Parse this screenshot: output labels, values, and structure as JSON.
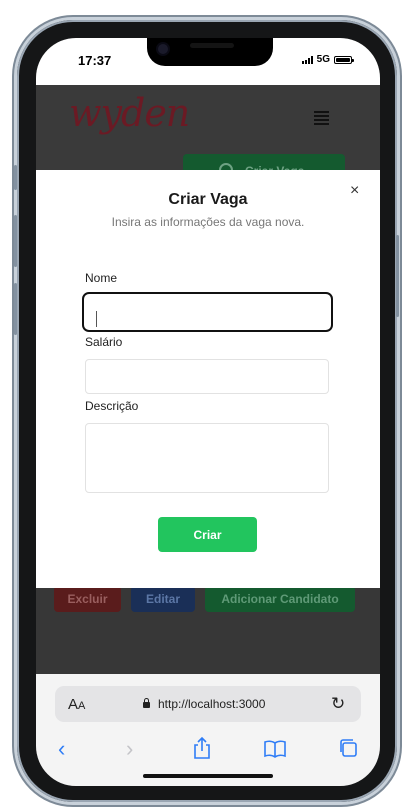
{
  "status": {
    "time": "17:37",
    "network": "5G"
  },
  "app": {
    "logo": "wyden",
    "create_button": "Criar Vaga",
    "row_buttons": {
      "delete": "Excluir",
      "edit": "Editar",
      "add": "Adicionar Candidato"
    }
  },
  "modal": {
    "title": "Criar Vaga",
    "subtitle": "Insira as informações da vaga nova.",
    "close": "×",
    "fields": {
      "name_label": "Nome",
      "name_value": "",
      "salary_label": "Salário",
      "salary_value": "",
      "description_label": "Descrição",
      "description_value": ""
    },
    "submit": "Criar"
  },
  "safari": {
    "aa": "A",
    "aa_small": "A",
    "url": "http://localhost:3000"
  },
  "colors": {
    "submit": "#22c55e",
    "logo": "#6b1a24",
    "link": "#2f7df6"
  },
  "icons": [
    "menu-icon",
    "lock-icon",
    "reload-icon",
    "back-icon",
    "forward-icon",
    "share-icon",
    "bookmarks-icon",
    "tabs-icon"
  ]
}
